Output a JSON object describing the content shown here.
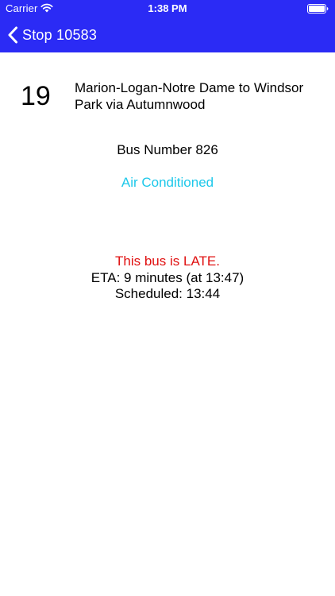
{
  "status_bar": {
    "carrier": "Carrier",
    "time": "1:38 PM",
    "wifi_icon": "wifi-icon",
    "battery_icon": "battery-icon"
  },
  "nav": {
    "back_label": "Stop 10583",
    "back_icon": "chevron-left-icon"
  },
  "route": {
    "number": "19",
    "name": "Marion-Logan-Notre Dame to Windsor Park via Autumnwood"
  },
  "bus": {
    "number_text": "Bus Number 826",
    "feature_text": "Air Conditioned"
  },
  "arrival": {
    "status_text": "This bus is LATE.",
    "eta_text": "ETA: 9 minutes (at 13:47)",
    "scheduled_text": "Scheduled: 13:44"
  },
  "colors": {
    "nav_background": "#2b2bf5",
    "nav_foreground": "#ffffff",
    "feature_text": "#1ec8ea",
    "late_status": "#e01010",
    "body_text": "#000000"
  }
}
